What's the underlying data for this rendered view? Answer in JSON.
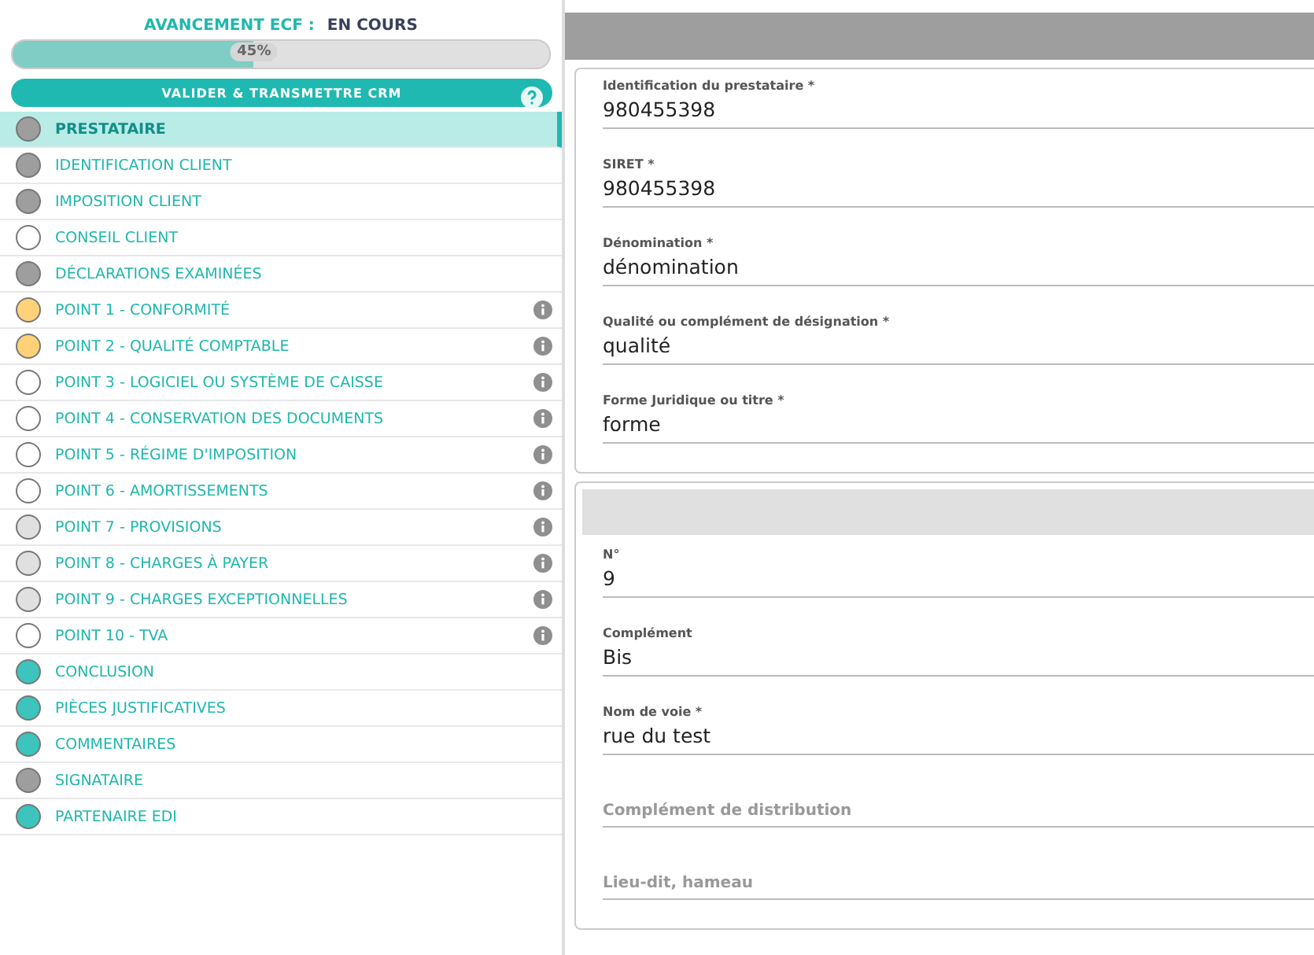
{
  "progress": {
    "label": "AVANCEMENT ECF :",
    "status": "EN COURS",
    "level": 0.45,
    "reading": "45%"
  },
  "validate_button": {
    "label": "VALIDER & TRANSMETTRE CRM"
  },
  "sections": [
    {
      "label": "PRESTATAIRE",
      "color": "#9e9e9e",
      "info": false,
      "selected": true
    },
    {
      "label": "IDENTIFICATION CLIENT",
      "color": "#9e9e9e",
      "info": false,
      "selected": false
    },
    {
      "label": "IMPOSITION CLIENT",
      "color": "#9e9e9e",
      "info": false,
      "selected": false
    },
    {
      "label": "CONSEIL CLIENT",
      "color": "#ffffff",
      "info": false,
      "selected": false
    },
    {
      "label": "DÉCLARATIONS EXAMINÉES",
      "color": "#9e9e9e",
      "info": false,
      "selected": false
    },
    {
      "label": "POINT 1 - CONFORMITÉ",
      "color": "#ffd27a",
      "info": true,
      "selected": false
    },
    {
      "label": "POINT 2 - QUALITÉ COMPTABLE",
      "color": "#ffd27a",
      "info": true,
      "selected": false
    },
    {
      "label": "POINT 3 - LOGICIEL OU SYSTÈME DE CAISSE",
      "color": "#ffffff",
      "info": true,
      "selected": false
    },
    {
      "label": "POINT 4 - CONSERVATION DES DOCUMENTS",
      "color": "#ffffff",
      "info": true,
      "selected": false
    },
    {
      "label": "POINT 5 - RÉGIME D'IMPOSITION",
      "color": "#ffffff",
      "info": true,
      "selected": false
    },
    {
      "label": "POINT 6 - AMORTISSEMENTS",
      "color": "#ffffff",
      "info": true,
      "selected": false
    },
    {
      "label": "POINT 7 - PROVISIONS",
      "color": "#e0e0e0",
      "info": true,
      "selected": false
    },
    {
      "label": "POINT 8 - CHARGES À PAYER",
      "color": "#e0e0e0",
      "info": true,
      "selected": false
    },
    {
      "label": "POINT 9 - CHARGES EXCEPTIONNELLES",
      "color": "#e0e0e0",
      "info": true,
      "selected": false
    },
    {
      "label": "POINT 10 - TVA",
      "color": "#ffffff",
      "info": true,
      "selected": false
    },
    {
      "label": "CONCLUSION",
      "color": "#3cc4bd",
      "info": false,
      "selected": false
    },
    {
      "label": "PIÈCES JUSTIFICATIVES",
      "color": "#3cc4bd",
      "info": false,
      "selected": false
    },
    {
      "label": "COMMENTAIRES",
      "color": "#3cc4bd",
      "info": false,
      "selected": false
    },
    {
      "label": "SIGNATAIRE",
      "color": "#9e9e9e",
      "info": false,
      "selected": false
    },
    {
      "label": "PARTENAIRE EDI",
      "color": "#3cc4bd",
      "info": false,
      "selected": false
    }
  ],
  "cards": [
    {
      "fields": [
        {
          "label": "Identification du prestataire *",
          "value": "980455398"
        },
        {
          "label": "SIRET *",
          "value": "980455398"
        },
        {
          "label": "Dénomination *",
          "value": "dénomination"
        },
        {
          "label": "Qualité ou complément de désignation *",
          "value": "qualité"
        },
        {
          "label": "Forme Juridique ou titre *",
          "value": "forme"
        }
      ]
    },
    {
      "fields": [
        {
          "label": "N°",
          "value": "9"
        },
        {
          "label": "Complément",
          "value": "Bis"
        },
        {
          "label": "Nom de voie *",
          "value": "rue du test"
        },
        {
          "placeholder": "Complément de distribution"
        },
        {
          "placeholder": "Lieu-dit, hameau"
        }
      ]
    }
  ]
}
